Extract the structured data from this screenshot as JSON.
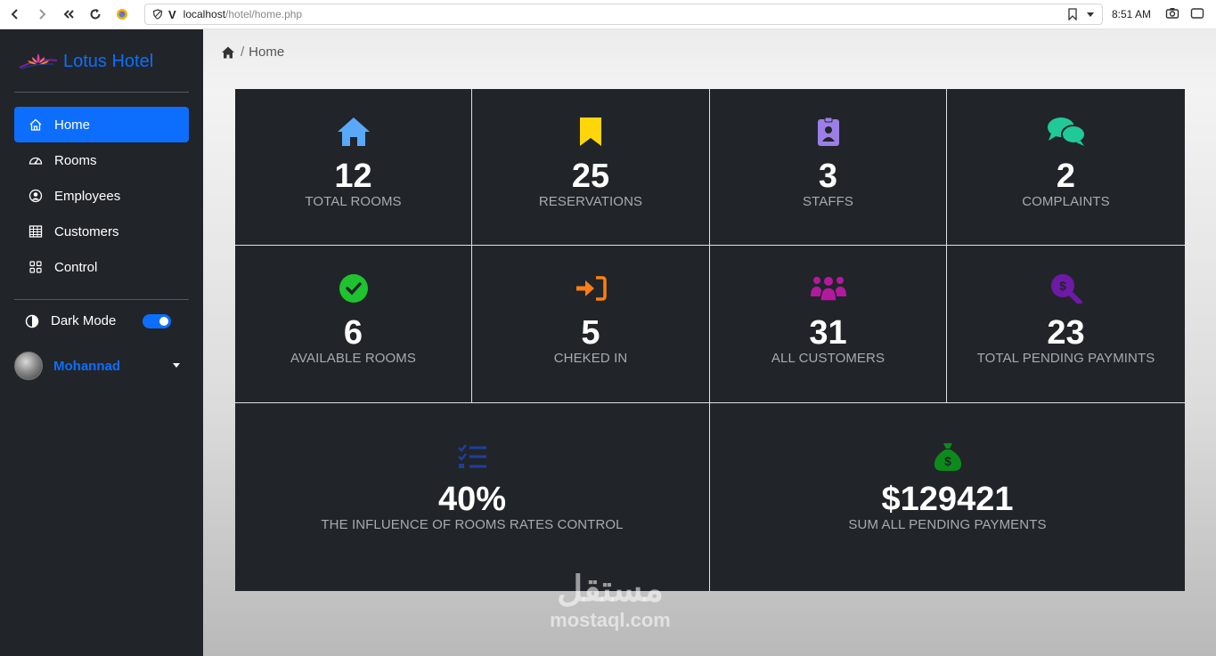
{
  "browser": {
    "url_host": "localhost",
    "url_path": "/hotel/home.php",
    "time": "8:51 AM"
  },
  "sidebar": {
    "brand": "Lotus Hotel",
    "items": [
      {
        "label": "Home",
        "icon": "home-icon",
        "active": true
      },
      {
        "label": "Rooms",
        "icon": "speedometer-icon",
        "active": false
      },
      {
        "label": "Employees",
        "icon": "user-circle-icon",
        "active": false
      },
      {
        "label": "Customers",
        "icon": "table-icon",
        "active": false
      },
      {
        "label": "Control",
        "icon": "grid-icon",
        "active": false
      }
    ],
    "dark_mode_label": "Dark Mode",
    "dark_mode_on": true,
    "user_name": "Mohannad"
  },
  "breadcrumb": {
    "current": "Home"
  },
  "stats": [
    {
      "value": "12",
      "label": "TOTAL ROOMS",
      "icon": "house-icon",
      "color": "#5aa9f8"
    },
    {
      "value": "25",
      "label": "RESERVATIONS",
      "icon": "bookmark-icon",
      "color": "#ffd60a"
    },
    {
      "value": "3",
      "label": "STAFFS",
      "icon": "id-badge-icon",
      "color": "#9b7fe6"
    },
    {
      "value": "2",
      "label": "COMPLAINTS",
      "icon": "chat-bubbles-icon",
      "color": "#20c997"
    },
    {
      "value": "6",
      "label": "AVAILABLE ROOMS",
      "icon": "check-circle-icon",
      "color": "#1fc32f"
    },
    {
      "value": "5",
      "label": "CHEKED IN",
      "icon": "sign-in-icon",
      "color": "#fd7e14"
    },
    {
      "value": "31",
      "label": "ALL CUSTOMERS",
      "icon": "people-group-icon",
      "color": "#b3199f"
    },
    {
      "value": "23",
      "label": "TOTAL PENDING PAYMINTS",
      "icon": "dollar-search-icon",
      "color": "#6f19a8"
    },
    {
      "value": "40%",
      "label": "THE INFLUENCE OF ROOMS RATES CONTROL",
      "icon": "list-check-icon",
      "color": "#1d3fa0"
    },
    {
      "value": "$129421",
      "label": "SUM ALL PENDING PAYMENTS",
      "icon": "money-bag-icon",
      "color": "#0d8a1c"
    }
  ],
  "watermark": {
    "arabic": "مستقل",
    "latin": "mostaql.com"
  }
}
